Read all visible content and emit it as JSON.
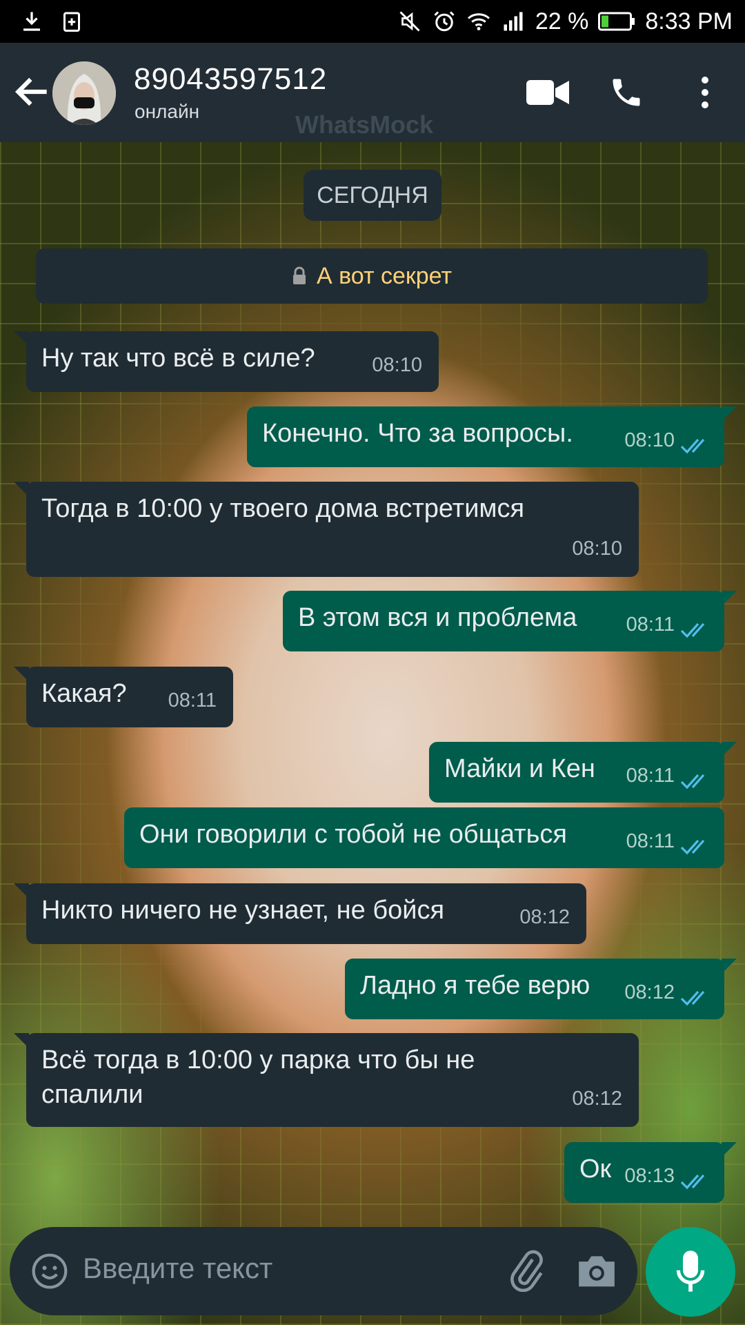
{
  "status_bar": {
    "battery": "22 %",
    "time": "8:33 PM"
  },
  "header": {
    "contact": "89043597512",
    "status": "онлайн",
    "watermark": "WhatsMock"
  },
  "chat": {
    "date_chip": "СЕГОДНЯ",
    "secret_banner": "А вот секрет",
    "messages": [
      {
        "direction": "in",
        "text": "Ну так что всё в силе?",
        "time": "08:10"
      },
      {
        "direction": "out",
        "text": "Конечно. Что за вопросы.",
        "time": "08:10",
        "read": true
      },
      {
        "direction": "in",
        "text": "Тогда в 10:00 у твоего дома встретимся",
        "time": "08:10"
      },
      {
        "direction": "out",
        "text": "В этом вся и проблема",
        "time": "08:11",
        "read": true
      },
      {
        "direction": "in",
        "text": "Какая?",
        "time": "08:11"
      },
      {
        "direction": "out",
        "text": "Майки и Кен",
        "time": "08:11",
        "read": true
      },
      {
        "direction": "out",
        "text": "Они говорили с тобой не общаться",
        "time": "08:11",
        "read": true
      },
      {
        "direction": "in",
        "text": "Никто ничего не узнает, не бойся",
        "time": "08:12"
      },
      {
        "direction": "out",
        "text": "Ладно я тебе верю",
        "time": "08:12",
        "read": true
      },
      {
        "direction": "in",
        "text": "Всё тогда в 10:00 у парка что бы не\nспалили",
        "time": "08:12"
      },
      {
        "direction": "out",
        "text": "Ок",
        "time": "08:13",
        "read": true
      }
    ]
  },
  "composer": {
    "placeholder": "Введите текст"
  },
  "colors": {
    "header_bg": "#232d36",
    "incoming_bubble": "#202c33",
    "outgoing_bubble": "#005c4b",
    "accent": "#00a884",
    "read_ticks": "#53bdeb",
    "banner_text": "#ffd279"
  },
  "icons": [
    "download-icon",
    "add-box-icon",
    "mute-icon",
    "alarm-icon",
    "wifi-icon",
    "signal-icon",
    "battery-icon",
    "back-arrow-icon",
    "video-call-icon",
    "phone-icon",
    "more-vert-icon",
    "lock-icon",
    "emoji-icon",
    "attach-icon",
    "camera-icon",
    "mic-icon"
  ]
}
